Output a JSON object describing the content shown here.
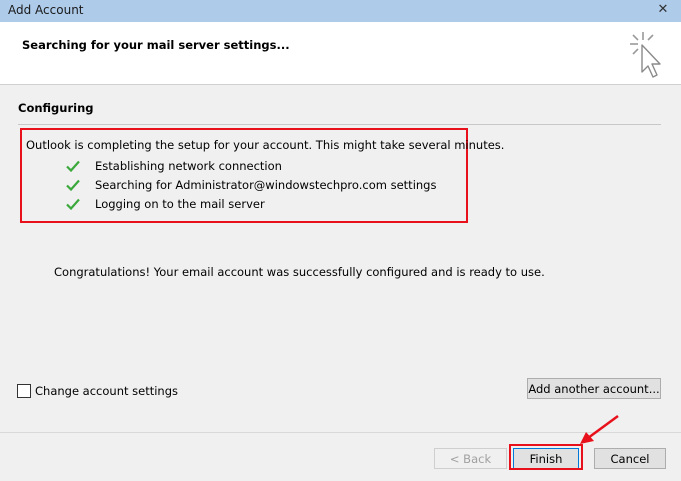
{
  "window": {
    "title": "Add Account",
    "close_glyph": "✕"
  },
  "header": {
    "title": "Searching for your mail server settings...",
    "icon": "cursor-sparkle-icon"
  },
  "configuring": {
    "section_title": "Configuring",
    "status_message": "Outlook is completing the setup for your account. This might take several minutes.",
    "tasks": [
      {
        "label": "Establishing network connection",
        "status": "done"
      },
      {
        "label": "Searching for Administrator@windowstechpro.com settings",
        "status": "done"
      },
      {
        "label": "Logging on to the mail server",
        "status": "done"
      }
    ]
  },
  "congrats_message": "Congratulations! Your email account was successfully configured and is ready to use.",
  "options": {
    "change_settings_label": "Change account settings",
    "change_settings_checked": false,
    "add_another_label": "Add another account..."
  },
  "footer": {
    "back_label": "< Back",
    "finish_label": "Finish",
    "cancel_label": "Cancel"
  },
  "colors": {
    "titlebar": "#aecbea",
    "highlight": "#e8101a",
    "check": "#3aa83a"
  }
}
